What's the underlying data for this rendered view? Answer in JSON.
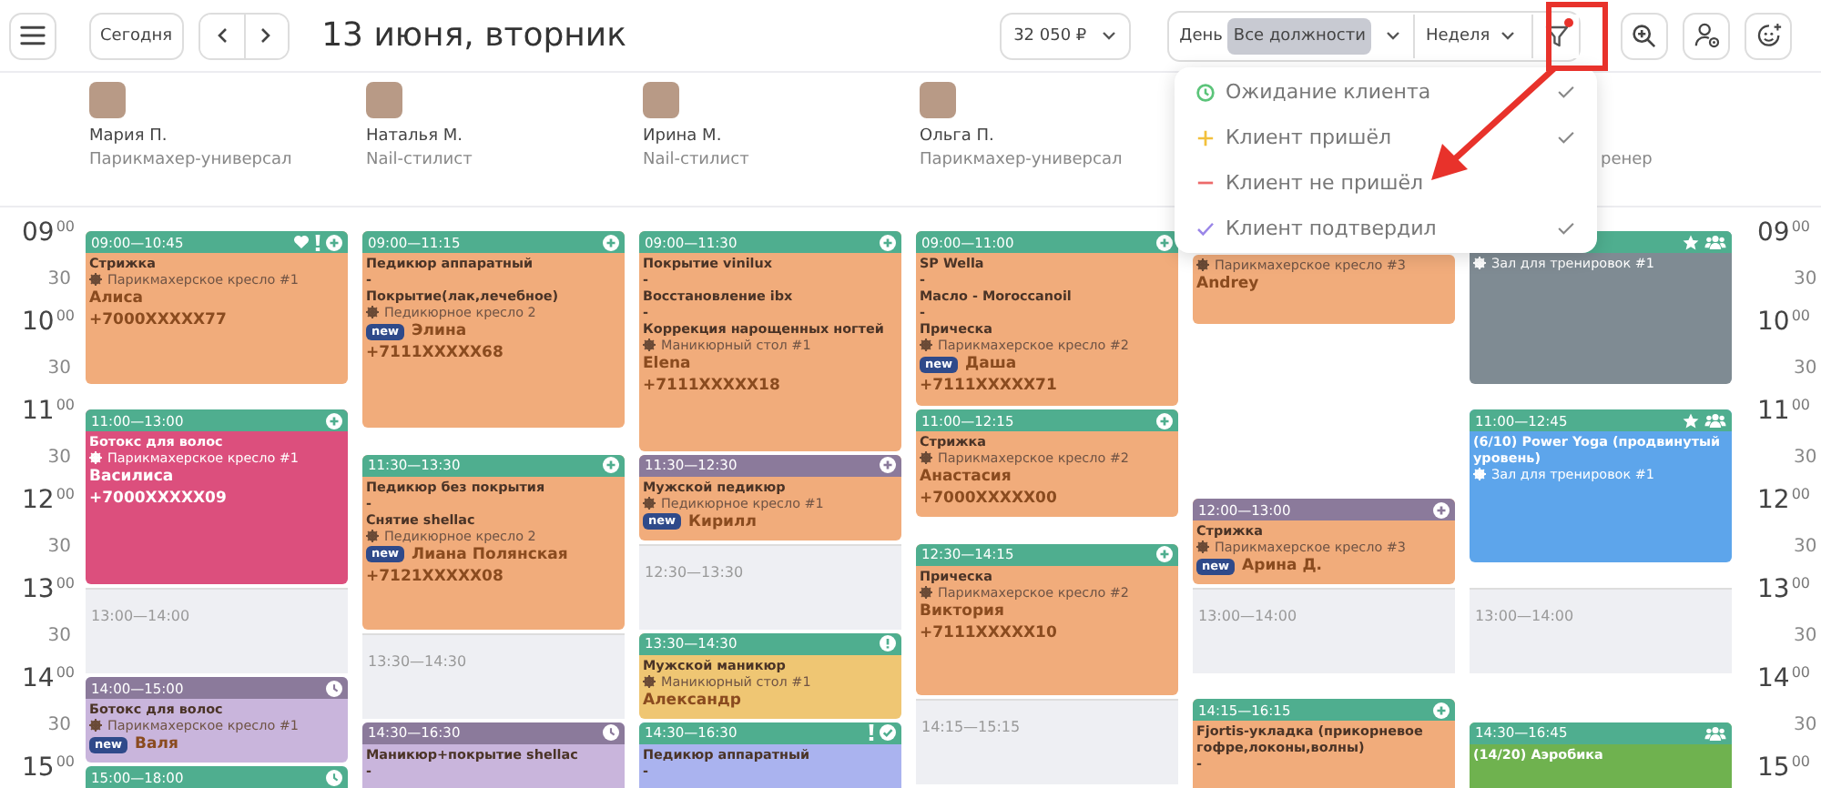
{
  "toolbar": {
    "today": "Сегодня",
    "title": "13 июня, вторник",
    "revenue": "32 050 ₽",
    "day": "День",
    "position_filter": {
      "label": "Все должности",
      "active": true
    },
    "week": "Неделя",
    "filter_active": true
  },
  "filter_menu": [
    {
      "kind": "waiting",
      "color": "#5cc47a",
      "label": "Ожидание клиента",
      "checked": true
    },
    {
      "kind": "arrived",
      "color": "#f2c03c",
      "label": "Клиент пришёл",
      "checked": true
    },
    {
      "kind": "absent",
      "color": "#ec6a6a",
      "label": "Клиент не пришёл",
      "checked": false
    },
    {
      "kind": "confirmed",
      "color": "#9a86e8",
      "label": "Клиент подтвердил",
      "checked": true
    }
  ],
  "time_axis_left": [
    {
      "hour": "09",
      "minutes": "00",
      "half": "30"
    },
    {
      "hour": "10",
      "minutes": "00",
      "half": "30"
    },
    {
      "hour": "11",
      "minutes": "00",
      "half": "30"
    },
    {
      "hour": "12",
      "minutes": "00",
      "half": "30"
    },
    {
      "hour": "13",
      "minutes": "00",
      "half": "30"
    },
    {
      "hour": "14",
      "minutes": "00",
      "half": "30"
    },
    {
      "hour": "15",
      "minutes": "00"
    }
  ],
  "time_axis_right": [
    {
      "hour": "09",
      "minutes": "00",
      "half": "30"
    },
    {
      "hour": "10",
      "minutes": "00",
      "half": "30"
    },
    {
      "hour": "11",
      "minutes": "00",
      "half": "30"
    },
    {
      "hour": "12",
      "minutes": "00",
      "half": "30"
    },
    {
      "hour": "13",
      "minutes": "00",
      "half": "30"
    },
    {
      "hour": "14",
      "minutes": "00",
      "half": "30"
    },
    {
      "hour": "15",
      "minutes": "00"
    }
  ],
  "columns": [
    {
      "staff": {
        "name": "Мария П.",
        "role": "Парикмахер-универсал"
      },
      "events": [
        {
          "kind": "appointment",
          "time": "09:00—10:45",
          "header": {
            "color": "#4fae8f"
          },
          "color": "#f1ac7b",
          "status": {
            "kind": "arrived"
          },
          "favorite": true,
          "urgent": true,
          "services": [
            "Стрижка"
          ],
          "place": "Парикмахерское кресло #1",
          "client": "Алиса",
          "phone": "+7000XXXXX77"
        },
        {
          "kind": "appointment",
          "time": "11:00—13:00",
          "header": {
            "color": "#4fae8f"
          },
          "color": "#dc4f7d",
          "status": {
            "kind": "arrived"
          },
          "favorite": false,
          "urgent": false,
          "services": [
            "Ботокс для волос"
          ],
          "place": "Парикмахерское кресло #1",
          "client": "Василиса",
          "phone": "+7000XXXXX09"
        },
        {
          "kind": "free",
          "time": "13:00—14:00"
        },
        {
          "kind": "appointment",
          "time": "14:00—15:00",
          "header": {
            "color": "#8b7a9b"
          },
          "color": "#c9b5dc",
          "status": {
            "kind": "waiting"
          },
          "favorite": false,
          "urgent": false,
          "services": [
            "Ботокс для волос"
          ],
          "place": "Парикмахерское кресло #1",
          "client": "Валя",
          "badge": "new"
        },
        {
          "kind": "appointment",
          "time": "15:00—18:00",
          "header": {
            "color": "#4fae8f"
          },
          "status": {
            "kind": "waiting"
          },
          "favorite": false,
          "urgent": false
        }
      ]
    },
    {
      "staff": {
        "name": "Наталья М.",
        "role": "Nail-стилист"
      },
      "events": [
        {
          "kind": "appointment",
          "time": "09:00—11:15",
          "header": {
            "color": "#4fae8f"
          },
          "color": "#f1ac7b",
          "status": {
            "kind": "arrived"
          },
          "favorite": false,
          "urgent": false,
          "services": [
            "Педикюр аппаратный",
            "-",
            "Покрытие(лак,лечебное)"
          ],
          "place": "Педикюрное кресло 2",
          "client": "Элина",
          "badge": "new",
          "phone": "+7111XXXXX68"
        },
        {
          "kind": "appointment",
          "time": "11:30—13:30",
          "header": {
            "color": "#4fae8f"
          },
          "color": "#f1ac7b",
          "status": {
            "kind": "arrived"
          },
          "favorite": false,
          "urgent": false,
          "services": [
            "Педикюр без покрытия",
            "-",
            "Снятие shellac"
          ],
          "place": "Педикюрное кресло 2",
          "client": "Лиана Полянская",
          "badge": "new",
          "phone": "+7121XXXXX08"
        },
        {
          "kind": "free",
          "time": "13:30—14:30"
        },
        {
          "kind": "appointment",
          "time": "14:30—16:30",
          "header": {
            "color": "#8b7a9b"
          },
          "color": "#c9b5dc",
          "status": {
            "kind": "waiting"
          },
          "favorite": false,
          "urgent": false,
          "services": [
            "Маникюр+покрытие shellac",
            "-"
          ]
        }
      ]
    },
    {
      "staff": {
        "name": "Ирина М.",
        "role": "Nail-стилист"
      },
      "events": [
        {
          "kind": "appointment",
          "time": "09:00—11:30",
          "header": {
            "color": "#4fae8f"
          },
          "color": "#f1ac7b",
          "status": {
            "kind": "arrived"
          },
          "favorite": false,
          "urgent": false,
          "services": [
            "Покрытие vinilux",
            "-",
            "Восстановление ibx",
            "-",
            "Коррекция нарощенных ногтей"
          ],
          "place": "Маникюрный стол #1",
          "client": "Elena",
          "phone": "+7111XXXXX18"
        },
        {
          "kind": "appointment",
          "time": "11:30—12:30",
          "header": {
            "color": "#8b7a9b"
          },
          "color": "#f1ac7b",
          "status": {
            "kind": "arrived"
          },
          "favorite": false,
          "urgent": false,
          "services": [
            "Мужской педикюр"
          ],
          "place": "Педикюрное кресло #1",
          "client": "Кирилл",
          "badge": "new"
        },
        {
          "kind": "free",
          "time": "12:30—13:30"
        },
        {
          "kind": "appointment",
          "time": "13:30—14:30",
          "header": {
            "color": "#4fae8f"
          },
          "color": "#efc673",
          "status": {
            "kind": "alert"
          },
          "favorite": false,
          "urgent": false,
          "services": [
            "Мужской маникюр"
          ],
          "place": "Маникюрный стол #1",
          "client": "Александр"
        },
        {
          "kind": "appointment",
          "time": "14:30—16:30",
          "header": {
            "color": "#4fae8f"
          },
          "color": "#aab3ef",
          "status": {
            "kind": "confirmed"
          },
          "favorite": false,
          "urgent": true,
          "services": [
            "Педикюр аппаратный",
            "-"
          ]
        }
      ]
    },
    {
      "staff": {
        "name": "Ольга П.",
        "role": "Парикмахер-универсал"
      },
      "events": [
        {
          "kind": "appointment",
          "time": "09:00—11:00",
          "header": {
            "color": "#4fae8f"
          },
          "color": "#f1ac7b",
          "status": {
            "kind": "arrived"
          },
          "favorite": false,
          "urgent": false,
          "services": [
            "SP Wella",
            "-",
            "Масло - Moroccanoil",
            "-",
            "Прическа"
          ],
          "place": "Парикмахерское кресло #2",
          "client": "Даша",
          "badge": "new",
          "phone": "+7111XXXXX71"
        },
        {
          "kind": "appointment",
          "time": "11:00—12:15",
          "header": {
            "color": "#4fae8f"
          },
          "color": "#f1ac7b",
          "status": {
            "kind": "arrived"
          },
          "favorite": false,
          "urgent": false,
          "services": [
            "Стрижка"
          ],
          "place": "Парикмахерское кресло #2",
          "client": "Анастасия",
          "phone": "+7000XXXXX00"
        },
        {
          "kind": "appointment",
          "time": "12:30—14:15",
          "header": {
            "color": "#4fae8f"
          },
          "color": "#f1ac7b",
          "status": {
            "kind": "arrived"
          },
          "favorite": false,
          "urgent": false,
          "services": [
            "Прическа"
          ],
          "place": "Парикмахерское кресло #2",
          "client": "Виктория",
          "phone": "+7111XXXXX10"
        },
        {
          "kind": "free",
          "time": "14:15—15:15"
        }
      ]
    },
    {
      "events": [
        {
          "kind": "appointment",
          "color": "#f1ac7b",
          "place": "Парикмахерское кресло #3",
          "client": "Andrey"
        },
        {
          "kind": "appointment",
          "time": "12:00—13:00",
          "header": {
            "color": "#8b7a9b"
          },
          "color": "#f1ac7b",
          "status": {
            "kind": "arrived"
          },
          "favorite": false,
          "urgent": false,
          "services": [
            "Стрижка"
          ],
          "place": "Парикмахерское кресло #3",
          "client": "Арина Д.",
          "badge": "new"
        },
        {
          "kind": "free",
          "time": "13:00—14:00"
        },
        {
          "kind": "appointment",
          "time": "14:15—16:15",
          "header": {
            "color": "#4fae8f"
          },
          "color": "#f1ac7b",
          "status": {
            "kind": "arrived"
          },
          "favorite": false,
          "urgent": false,
          "services": [
            "Fjortis-укладка (прикорневое гофре,локоны,волны)",
            "-"
          ]
        }
      ]
    },
    {
      "staff": {
        "role": "ренер"
      },
      "events": [
        {
          "kind": "class",
          "header": {
            "color": "#4fae8f"
          },
          "color": "#7f8b93",
          "featured": true,
          "group": true,
          "place": "Зал для тренировок #1"
        },
        {
          "kind": "class",
          "time": "11:00—12:45",
          "header": {
            "color": "#4fae8f"
          },
          "color": "#5da5eb",
          "featured": true,
          "group": true,
          "services": [
            "(6/10) Power Yoga (продвинутый уровень)"
          ],
          "place": "Зал для тренировок #1"
        },
        {
          "kind": "free",
          "time": "13:00—14:00"
        },
        {
          "kind": "class",
          "time": "14:30—16:45",
          "header": {
            "color": "#4fae8f"
          },
          "color": "#6fb24f",
          "featured": false,
          "group": true,
          "services": [
            "(14/20) Аэробика"
          ]
        }
      ]
    }
  ]
}
